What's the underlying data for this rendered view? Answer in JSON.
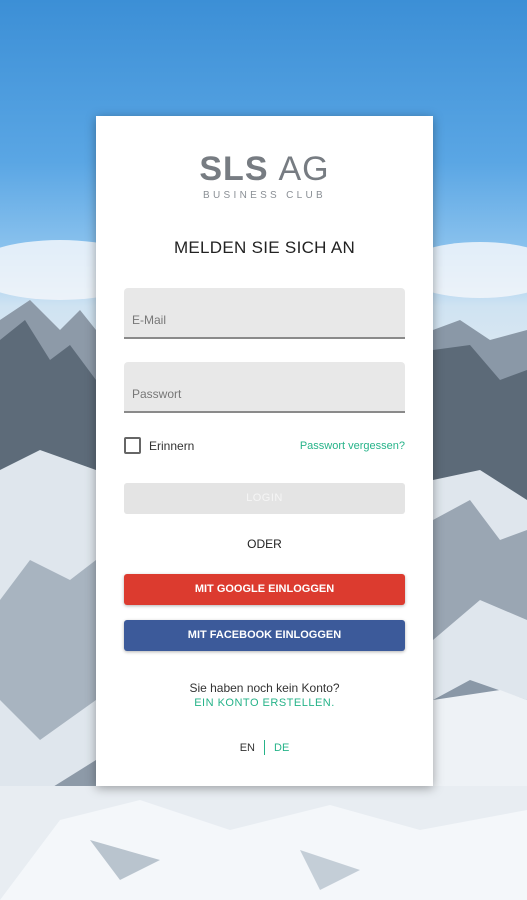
{
  "logo": {
    "main_bold": "SLS",
    "main_light": "AG",
    "subtitle": "BUSINESS CLUB"
  },
  "heading": "MELDEN SIE SICH AN",
  "email": {
    "placeholder": "E-Mail",
    "value": ""
  },
  "password": {
    "placeholder": "Passwort",
    "value": ""
  },
  "remember": {
    "label": "Erinnern",
    "checked": false
  },
  "forgot_link": "Passwort vergessen?",
  "login_button": "LOGIN",
  "or_text": "ODER",
  "google_button": "MIT GOOGLE EINLOGGEN",
  "facebook_button": "MIT FACEBOOK EINLOGGEN",
  "no_account_text": "Sie haben noch kein Konto?",
  "create_account_link": "EIN KONTO ERSTELLEN.",
  "languages": {
    "en": "EN",
    "de": "DE",
    "active": "DE"
  },
  "colors": {
    "accent": "#26b389",
    "google": "#dc3b2f",
    "facebook": "#3c5a9a"
  }
}
